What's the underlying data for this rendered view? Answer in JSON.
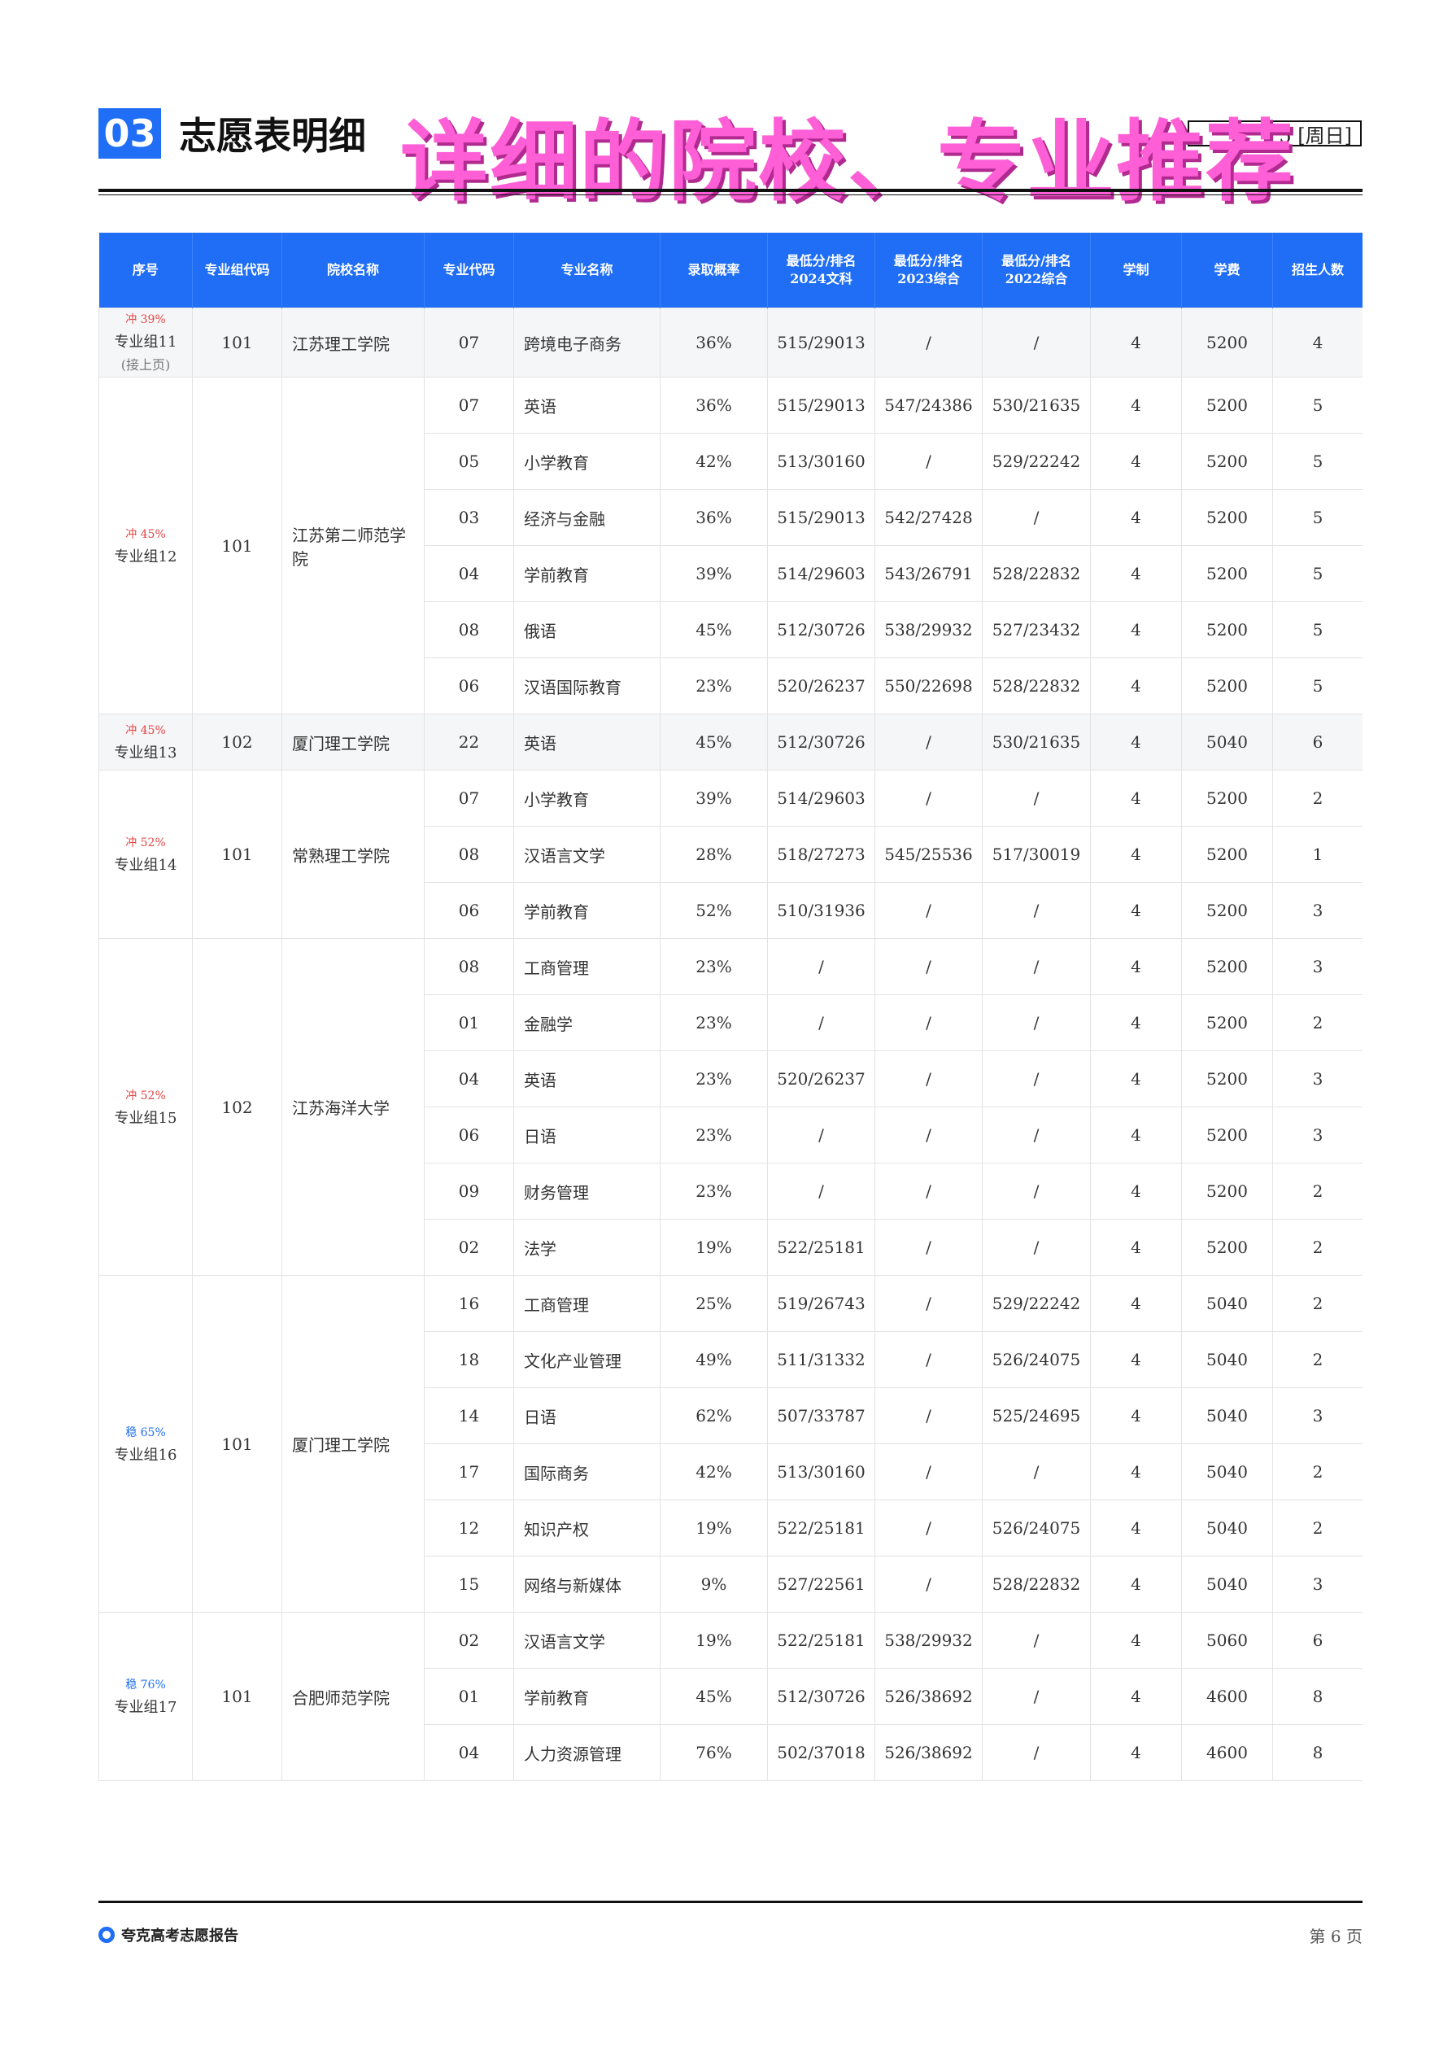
{
  "header": {
    "section_no": "03",
    "section_title": "志愿表明细",
    "overlay_text": "详细的院校、专业推荐",
    "date_text": "5 [周日]"
  },
  "table": {
    "columns": [
      "序号",
      "专业组代码",
      "院校名称",
      "专业代码",
      "专业名称",
      "录取概率",
      "最低分/排名\n2024文科",
      "最低分/排名\n2023综合",
      "最低分/排名\n2022综合",
      "学制",
      "学费",
      "招生人数"
    ],
    "groups": [
      {
        "tag": "冲 39%",
        "tag_type": "chong",
        "name": "专业组11",
        "note": "(接上页)",
        "code": "101",
        "school": "江苏理工学院",
        "shade": true,
        "rows": [
          [
            "07",
            "跨境电子商务",
            "36%",
            "515/29013",
            "/",
            "/",
            "4",
            "5200",
            "4"
          ]
        ]
      },
      {
        "tag": "冲 45%",
        "tag_type": "chong",
        "name": "专业组12",
        "note": "",
        "code": "101",
        "school": "江苏第二师范学院",
        "shade": false,
        "rows": [
          [
            "07",
            "英语",
            "36%",
            "515/29013",
            "547/24386",
            "530/21635",
            "4",
            "5200",
            "5"
          ],
          [
            "05",
            "小学教育",
            "42%",
            "513/30160",
            "/",
            "529/22242",
            "4",
            "5200",
            "5"
          ],
          [
            "03",
            "经济与金融",
            "36%",
            "515/29013",
            "542/27428",
            "/",
            "4",
            "5200",
            "5"
          ],
          [
            "04",
            "学前教育",
            "39%",
            "514/29603",
            "543/26791",
            "528/22832",
            "4",
            "5200",
            "5"
          ],
          [
            "08",
            "俄语",
            "45%",
            "512/30726",
            "538/29932",
            "527/23432",
            "4",
            "5200",
            "5"
          ],
          [
            "06",
            "汉语国际教育",
            "23%",
            "520/26237",
            "550/22698",
            "528/22832",
            "4",
            "5200",
            "5"
          ]
        ]
      },
      {
        "tag": "冲 45%",
        "tag_type": "chong",
        "name": "专业组13",
        "note": "",
        "code": "102",
        "school": "厦门理工学院",
        "shade": true,
        "rows": [
          [
            "22",
            "英语",
            "45%",
            "512/30726",
            "/",
            "530/21635",
            "4",
            "5040",
            "6"
          ]
        ]
      },
      {
        "tag": "冲 52%",
        "tag_type": "chong",
        "name": "专业组14",
        "note": "",
        "code": "101",
        "school": "常熟理工学院",
        "shade": false,
        "rows": [
          [
            "07",
            "小学教育",
            "39%",
            "514/29603",
            "/",
            "/",
            "4",
            "5200",
            "2"
          ],
          [
            "08",
            "汉语言文学",
            "28%",
            "518/27273",
            "545/25536",
            "517/30019",
            "4",
            "5200",
            "1"
          ],
          [
            "06",
            "学前教育",
            "52%",
            "510/31936",
            "/",
            "/",
            "4",
            "5200",
            "3"
          ]
        ]
      },
      {
        "tag": "冲 52%",
        "tag_type": "chong",
        "name": "专业组15",
        "note": "",
        "code": "102",
        "school": "江苏海洋大学",
        "shade": false,
        "rows": [
          [
            "08",
            "工商管理",
            "23%",
            "/",
            "/",
            "/",
            "4",
            "5200",
            "3"
          ],
          [
            "01",
            "金融学",
            "23%",
            "/",
            "/",
            "/",
            "4",
            "5200",
            "2"
          ],
          [
            "04",
            "英语",
            "23%",
            "520/26237",
            "/",
            "/",
            "4",
            "5200",
            "3"
          ],
          [
            "06",
            "日语",
            "23%",
            "/",
            "/",
            "/",
            "4",
            "5200",
            "3"
          ],
          [
            "09",
            "财务管理",
            "23%",
            "/",
            "/",
            "/",
            "4",
            "5200",
            "2"
          ],
          [
            "02",
            "法学",
            "19%",
            "522/25181",
            "/",
            "/",
            "4",
            "5200",
            "2"
          ]
        ]
      },
      {
        "tag": "稳 65%",
        "tag_type": "wen",
        "name": "专业组16",
        "note": "",
        "code": "101",
        "school": "厦门理工学院",
        "shade": false,
        "rows": [
          [
            "16",
            "工商管理",
            "25%",
            "519/26743",
            "/",
            "529/22242",
            "4",
            "5040",
            "2"
          ],
          [
            "18",
            "文化产业管理",
            "49%",
            "511/31332",
            "/",
            "526/24075",
            "4",
            "5040",
            "2"
          ],
          [
            "14",
            "日语",
            "62%",
            "507/33787",
            "/",
            "525/24695",
            "4",
            "5040",
            "3"
          ],
          [
            "17",
            "国际商务",
            "42%",
            "513/30160",
            "/",
            "/",
            "4",
            "5040",
            "2"
          ],
          [
            "12",
            "知识产权",
            "19%",
            "522/25181",
            "/",
            "526/24075",
            "4",
            "5040",
            "2"
          ],
          [
            "15",
            "网络与新媒体",
            "9%",
            "527/22561",
            "/",
            "528/22832",
            "4",
            "5040",
            "3"
          ]
        ]
      },
      {
        "tag": "稳 76%",
        "tag_type": "wen",
        "name": "专业组17",
        "note": "",
        "code": "101",
        "school": "合肥师范学院",
        "shade": false,
        "rows": [
          [
            "02",
            "汉语言文学",
            "19%",
            "522/25181",
            "538/29932",
            "/",
            "4",
            "5060",
            "6"
          ],
          [
            "01",
            "学前教育",
            "45%",
            "512/30726",
            "526/38692",
            "/",
            "4",
            "4600",
            "8"
          ],
          [
            "04",
            "人力资源管理",
            "76%",
            "502/37018",
            "526/38692",
            "/",
            "4",
            "4600",
            "8"
          ]
        ]
      }
    ]
  },
  "footer": {
    "brand": "夸克高考志愿报告",
    "page_label": "第 6 页"
  },
  "colors": {
    "accent": "#1f6ef5",
    "overlay": "#ff5fd6",
    "chong": "#e64545"
  }
}
